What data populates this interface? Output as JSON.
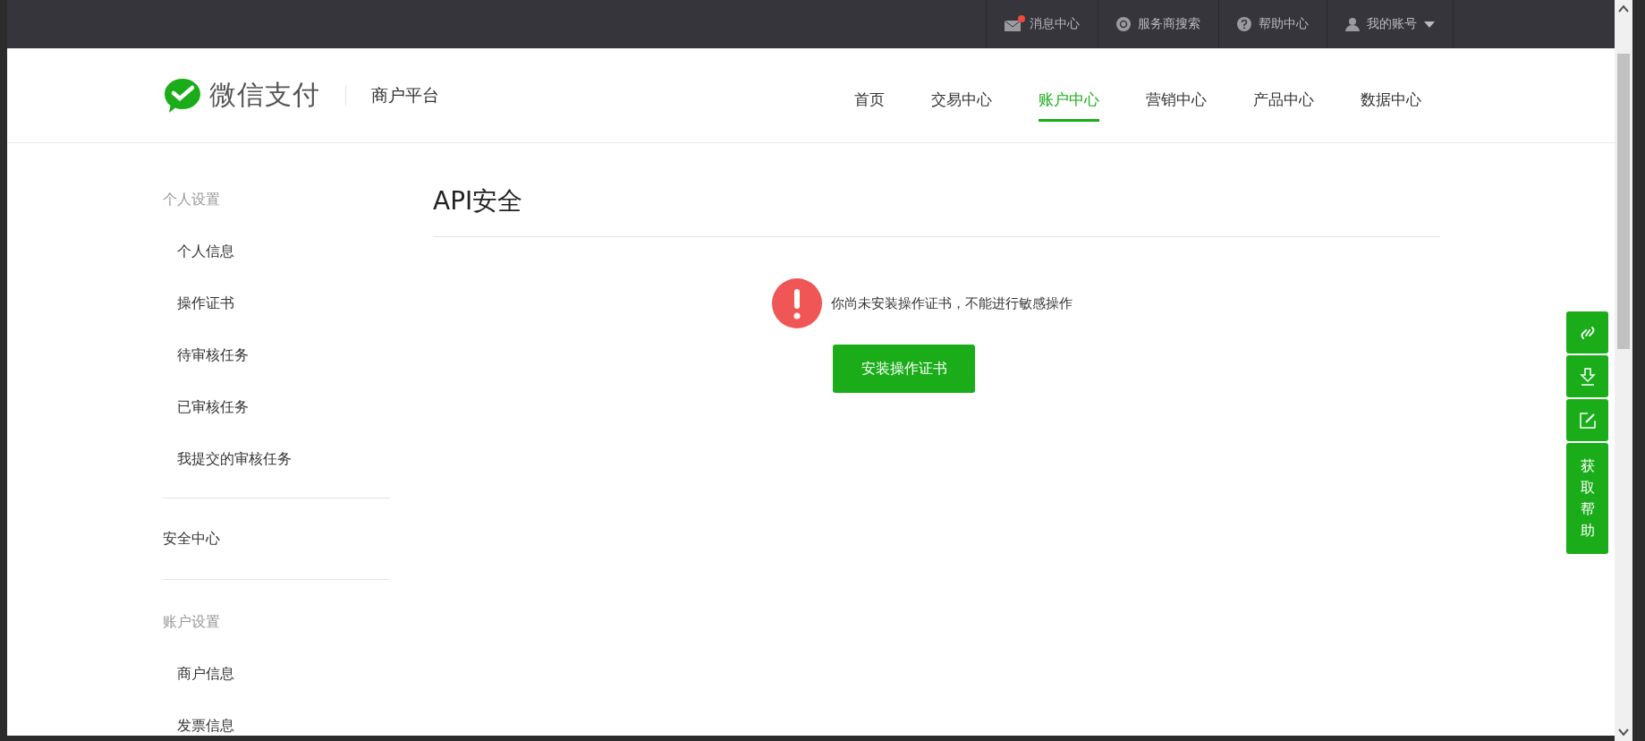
{
  "top_bar": {
    "items": [
      {
        "kind": "mail",
        "label": "消息中心",
        "unread": true
      },
      {
        "kind": "search",
        "label": "服务商搜索"
      },
      {
        "kind": "help",
        "label": "帮助中心"
      },
      {
        "kind": "user",
        "label": "我的账号",
        "dropdown": true
      }
    ]
  },
  "header": {
    "logo_text": "微信支付",
    "platform": "商户平台",
    "nav": [
      {
        "label": "首页",
        "selected": false
      },
      {
        "label": "交易中心",
        "selected": false
      },
      {
        "label": "账户中心",
        "selected": true
      },
      {
        "label": "营销中心",
        "selected": false
      },
      {
        "label": "产品中心",
        "selected": false
      },
      {
        "label": "数据中心",
        "selected": false
      }
    ]
  },
  "sidebar": {
    "sections": [
      {
        "title": "个人设置",
        "items": [
          "个人信息",
          "操作证书",
          "待审核任务",
          "已审核任务",
          "我提交的审核任务"
        ]
      },
      {
        "link": "安全中心"
      },
      {
        "title": "账户设置",
        "items": [
          "商户信息",
          "发票信息"
        ]
      }
    ]
  },
  "main": {
    "title": "API安全",
    "alert": "你尚未安装操作证书，不能进行敏感操作",
    "button": "安装操作证书"
  },
  "float_tools": {
    "buttons": [
      {
        "kind": "link"
      },
      {
        "kind": "download"
      },
      {
        "kind": "edit"
      }
    ],
    "help": "获取帮助"
  }
}
